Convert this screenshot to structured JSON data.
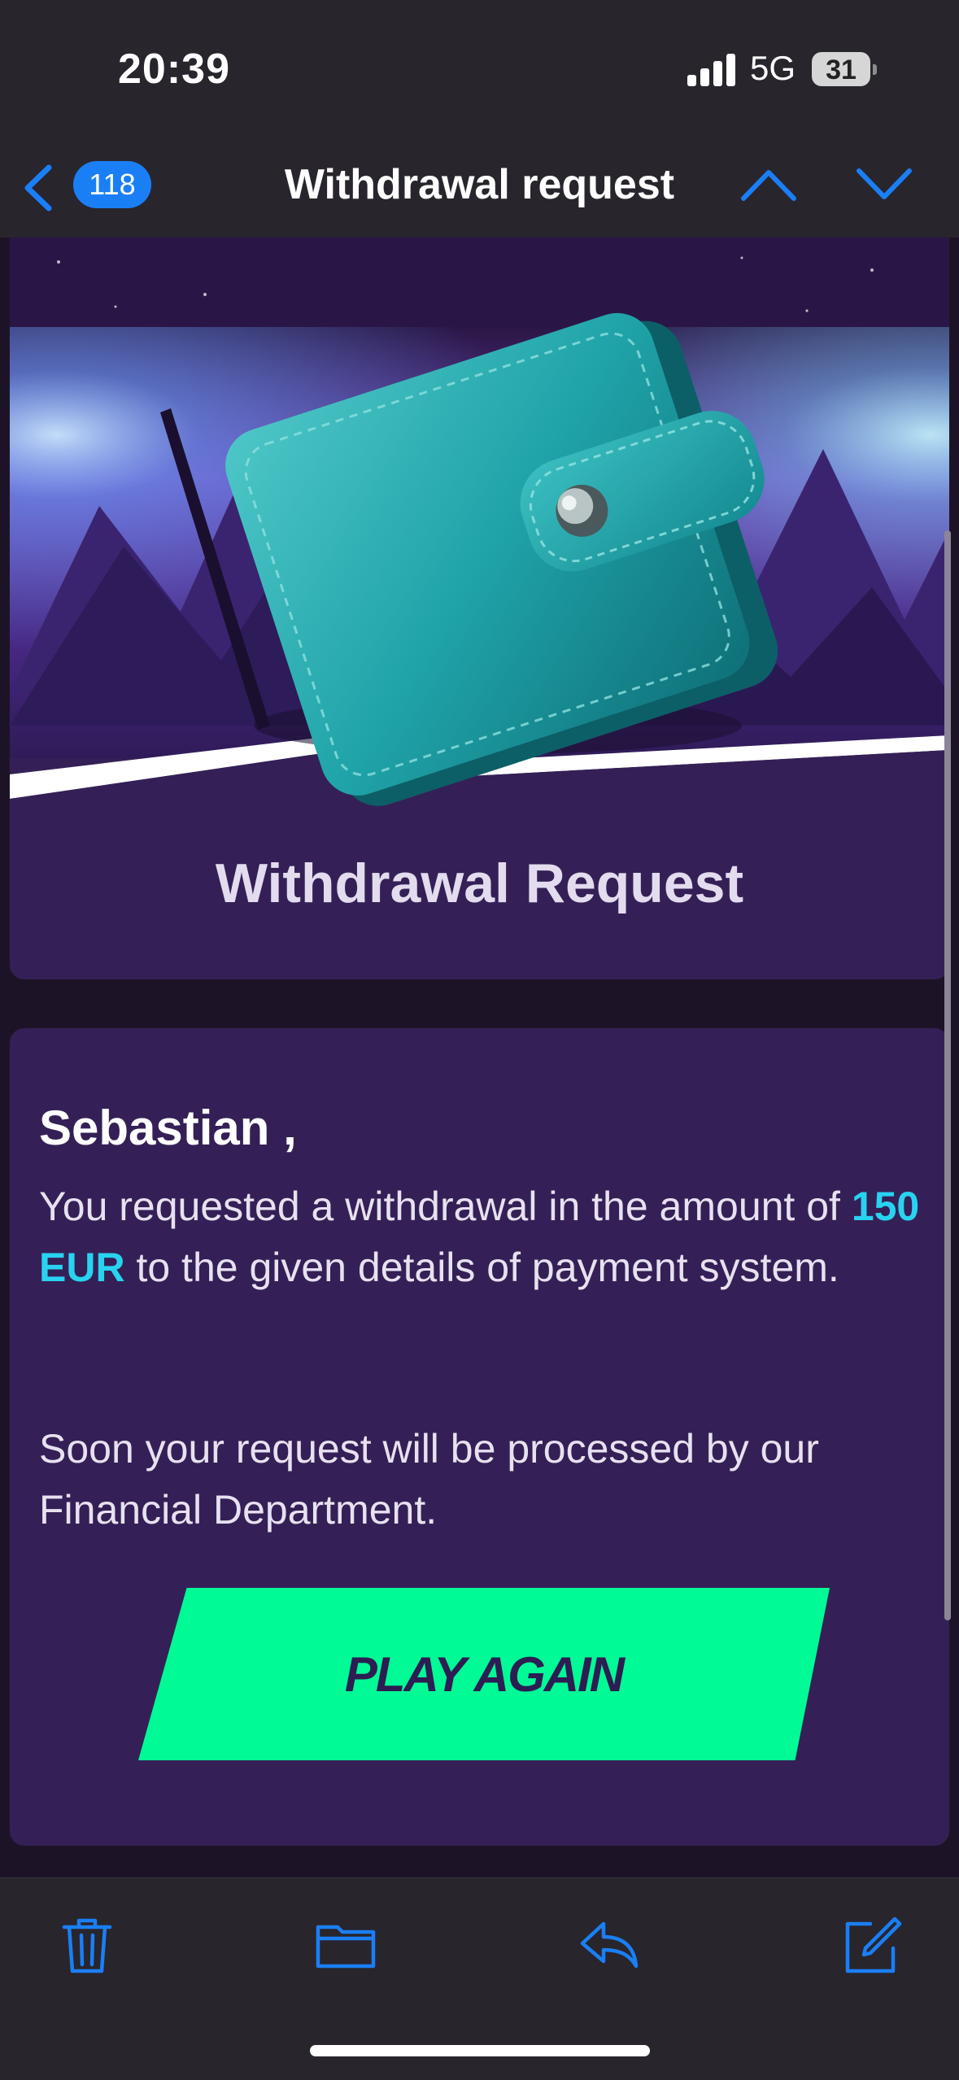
{
  "status_bar": {
    "time": "20:39",
    "network": "5G",
    "battery": "31"
  },
  "nav": {
    "unread_count": "118",
    "title": "Withdrawal request",
    "back_icon": "chevron-left-icon",
    "prev_icon": "chevron-up-icon",
    "next_icon": "chevron-down-icon"
  },
  "email": {
    "hero_title": "Withdrawal Request",
    "greeting": "Sebastian ,",
    "para1_before": "You requested a withdrawal in the amount of ",
    "amount": "150 EUR",
    "para1_after": " to the given details of payment system.",
    "para2": "Soon your request will be processed by our Financial Department.",
    "cta_label": "PLAY AGAIN"
  },
  "toolbar": {
    "icons": [
      "trash-icon",
      "folder-icon",
      "reply-icon",
      "compose-icon"
    ]
  },
  "colors": {
    "accent": "#1a7ff5",
    "card": "#342056",
    "amount": "#28d3f0",
    "cta": "#00fb96"
  }
}
